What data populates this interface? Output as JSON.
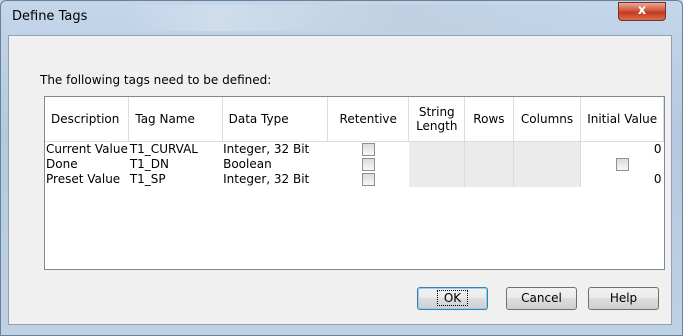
{
  "window": {
    "title": "Define Tags",
    "close_glyph": "x"
  },
  "prompt": "The following tags need to be defined:",
  "columns": [
    "Description",
    "Tag Name",
    "Data Type",
    "Retentive",
    "String Length",
    "Rows",
    "Columns",
    "Initial Value"
  ],
  "rows": [
    {
      "description": "Current Value",
      "tag_name": "T1_CURVAL",
      "data_type": "Integer, 32 Bit",
      "retentive": false,
      "initial_value": "0"
    },
    {
      "description": "Done",
      "tag_name": "T1_DN",
      "data_type": "Boolean",
      "retentive": false,
      "initial_value_checkbox": false
    },
    {
      "description": "Preset Value",
      "tag_name": "T1_SP",
      "data_type": "Integer, 32 Bit",
      "retentive": false,
      "initial_value": "0"
    }
  ],
  "buttons": {
    "ok": "OK",
    "cancel": "Cancel",
    "help": "Help"
  }
}
